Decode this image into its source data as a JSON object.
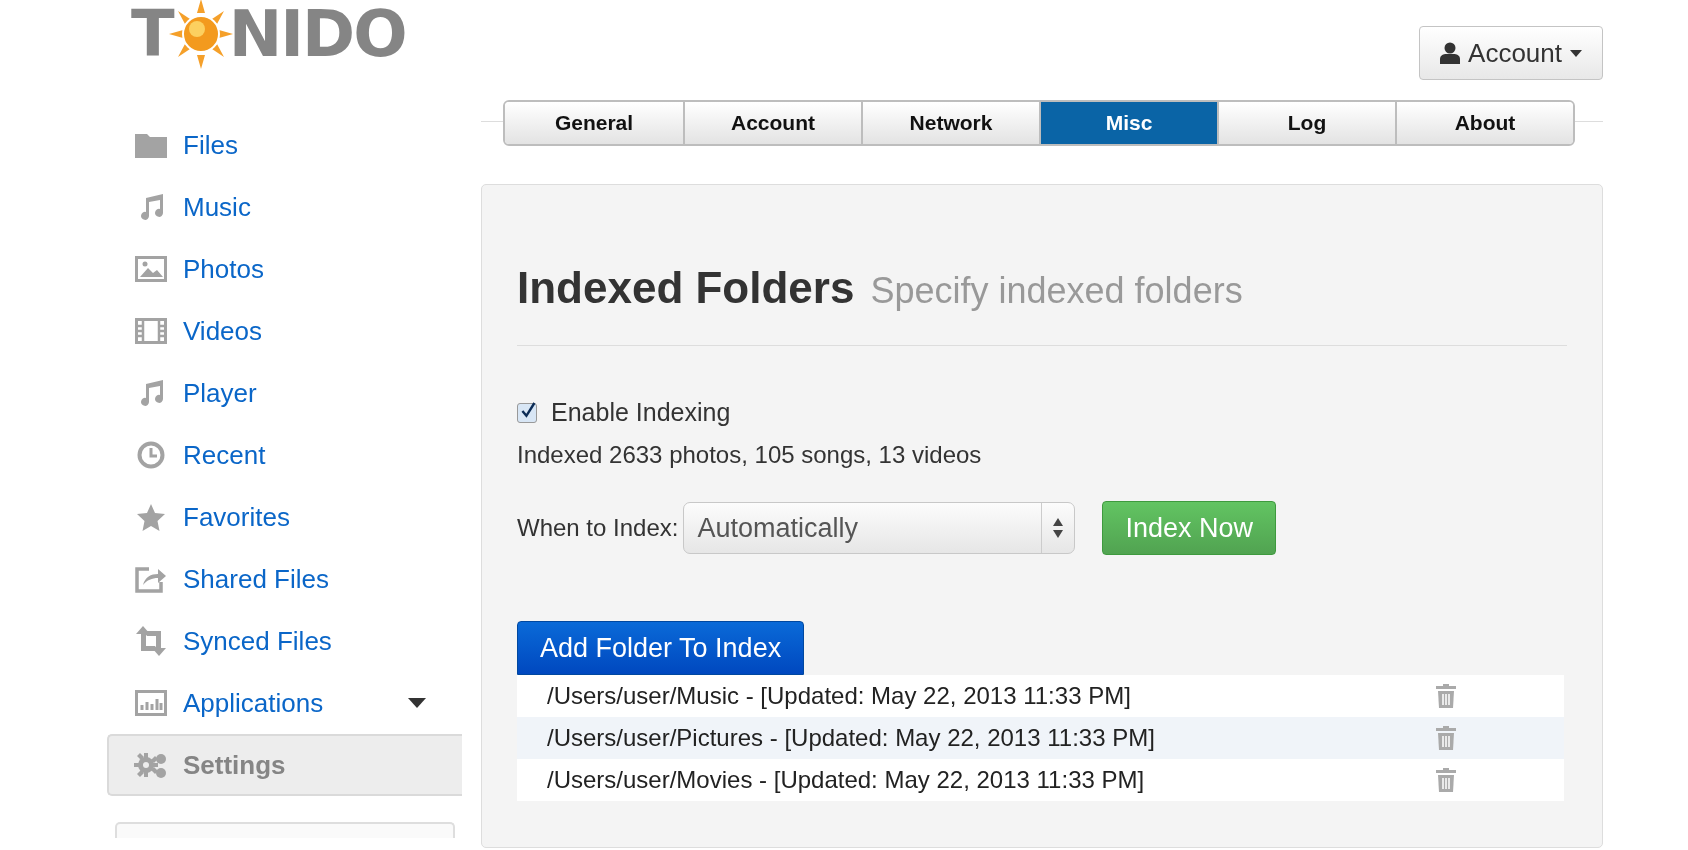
{
  "logo": {
    "before": "T",
    "after": "NIDO"
  },
  "account_button": {
    "label": "Account"
  },
  "sidebar": {
    "items": [
      {
        "label": "Files",
        "selected": false,
        "expandable": false
      },
      {
        "label": "Music",
        "selected": false,
        "expandable": false
      },
      {
        "label": "Photos",
        "selected": false,
        "expandable": false
      },
      {
        "label": "Videos",
        "selected": false,
        "expandable": false
      },
      {
        "label": "Player",
        "selected": false,
        "expandable": false
      },
      {
        "label": "Recent",
        "selected": false,
        "expandable": false
      },
      {
        "label": "Favorites",
        "selected": false,
        "expandable": false
      },
      {
        "label": "Shared Files",
        "selected": false,
        "expandable": false
      },
      {
        "label": "Synced Files",
        "selected": false,
        "expandable": false
      },
      {
        "label": "Applications",
        "selected": false,
        "expandable": true
      },
      {
        "label": "Settings",
        "selected": true,
        "expandable": false
      }
    ]
  },
  "tabs": [
    {
      "label": "General",
      "selected": false
    },
    {
      "label": "Account",
      "selected": false
    },
    {
      "label": "Network",
      "selected": false
    },
    {
      "label": "Misc",
      "selected": true
    },
    {
      "label": "Log",
      "selected": false
    },
    {
      "label": "About",
      "selected": false
    }
  ],
  "panel": {
    "title": "Indexed Folders",
    "subtitle": "Specify indexed folders",
    "enable_indexing": {
      "label": "Enable Indexing",
      "checked": true
    },
    "stats": "Indexed 2633 photos, 105 songs, 13 videos",
    "when_to_index": {
      "label": "When to Index:",
      "value": "Automatically"
    },
    "index_now_button": "Index Now",
    "add_folder_button": "Add Folder To Index",
    "folders": [
      {
        "text": "/Users/user/Music - [Updated: May 22, 2013 11:33 PM]"
      },
      {
        "text": "/Users/user/Pictures - [Updated: May 22, 2013 11:33 PM]"
      },
      {
        "text": "/Users/user/Movies - [Updated: May 22, 2013 11:33 PM]"
      }
    ]
  }
}
